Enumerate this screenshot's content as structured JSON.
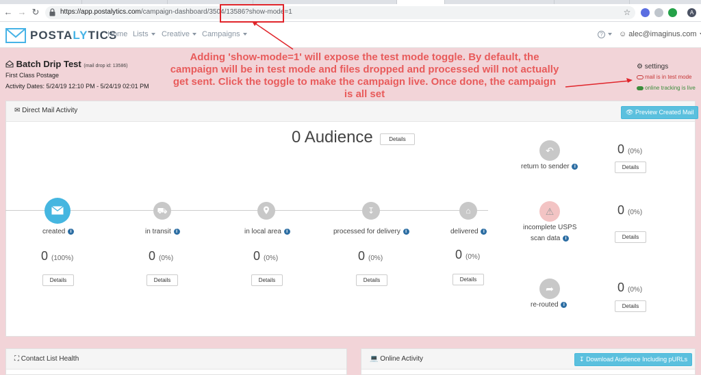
{
  "browser": {
    "url_host": "https://app.postalytics.com",
    "url_path": "/campaign-dashboard/3504/13586?show-mode=1",
    "profile_initial": "A"
  },
  "appnav": {
    "brand_post": "POST",
    "brand_a": "A",
    "brand_ly": "LY",
    "brand_rest": "TICS",
    "menu": [
      "Home",
      "Lists",
      "Creative",
      "Campaigns"
    ],
    "help": "?",
    "user_email": "alec@imaginus.com"
  },
  "campaign": {
    "title": "Batch Drip Test",
    "mail_id_text": "(mail drop id: 13586)",
    "postage": "First Class Postage",
    "activity_dates": "Activity Dates: 5/24/19 12:10 PM - 5/24/19 02:01 PM",
    "settings_label": "settings",
    "test_mode_label": "mail is in test mode",
    "tracking_label": "online tracking is live"
  },
  "annotation": {
    "text": "Adding 'show-mode=1' will expose the test mode toggle. By default, the campaign will be in test mode and files dropped and processed will not actually get sent. Click the toggle to make the campaign live. Once done, the campaign is all set"
  },
  "direct_mail": {
    "title": "Direct Mail Activity",
    "preview_button": "Preview Created Mail",
    "audience_count": "0 Audience",
    "details": "Details",
    "stages": [
      {
        "label": "created",
        "count": "0",
        "pct": "(100%)"
      },
      {
        "label": "in transit",
        "count": "0",
        "pct": "(0%)"
      },
      {
        "label": "in local area",
        "count": "0",
        "pct": "(0%)"
      },
      {
        "label": "processed for delivery",
        "count": "0",
        "pct": "(0%)"
      },
      {
        "label": "delivered",
        "count": "0",
        "pct": "(0%)"
      }
    ],
    "side": [
      {
        "label": "return to sender",
        "count": "0",
        "pct": "(0%)"
      },
      {
        "label_line1": "incomplete USPS",
        "label_line2": "scan data",
        "count": "0",
        "pct": "(0%)"
      },
      {
        "label": "re-routed",
        "count": "0",
        "pct": "(0%)"
      }
    ]
  },
  "contact_panel": {
    "title": "Contact List Health"
  },
  "online_panel": {
    "title": "Online Activity",
    "download_button": "Download Audience Including pURLs"
  },
  "colors": {
    "accent": "#45b6e0",
    "annotation": "#e85b5b",
    "page_bg": "#f2d4d8",
    "warn": "#c63838",
    "live": "#3c8d3c"
  },
  "icons": [
    "back-icon",
    "forward-icon",
    "refresh-icon",
    "lock-icon",
    "star-icon",
    "envelope-icon",
    "truck-icon",
    "map-pin-icon",
    "download-icon",
    "home-icon",
    "reply-icon",
    "warning-icon",
    "share-icon",
    "gear-icon",
    "eye-icon",
    "user-icon",
    "laptop-icon",
    "medkit-icon"
  ]
}
